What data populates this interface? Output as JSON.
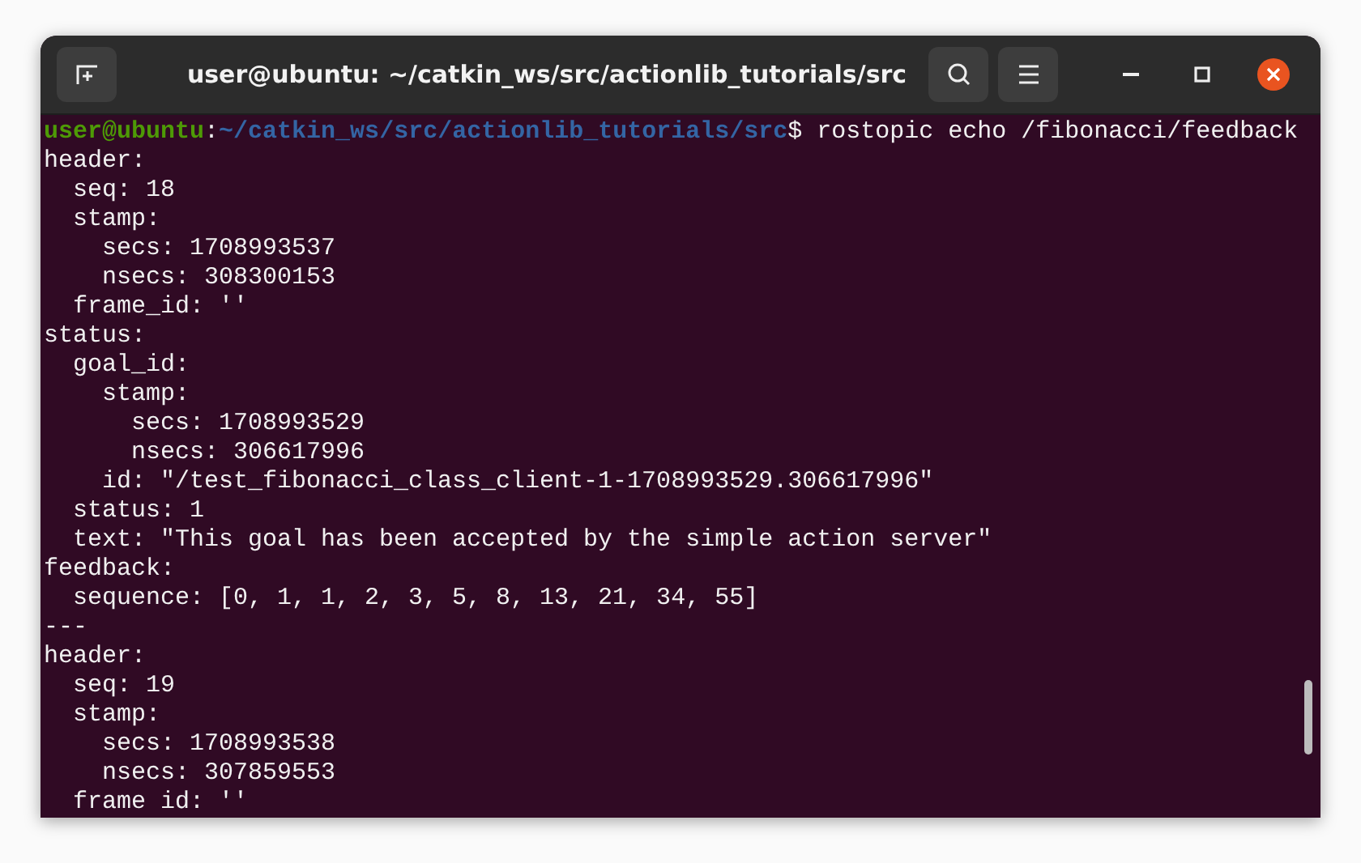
{
  "window": {
    "title": "user@ubuntu: ~/catkin_ws/src/actionlib_tutorials/src"
  },
  "prompt": {
    "user_host": "user@ubuntu",
    "separator": ":",
    "path": "~/catkin_ws/src/actionlib_tutorials/src",
    "command": "$ rostopic echo /fibonacci/feedback"
  },
  "output": [
    "header:",
    "  seq: 18",
    "  stamp:",
    "    secs: 1708993537",
    "    nsecs: 308300153",
    "  frame_id: ''",
    "status:",
    "  goal_id:",
    "    stamp:",
    "      secs: 1708993529",
    "      nsecs: 306617996",
    "    id: \"/test_fibonacci_class_client-1-1708993529.306617996\"",
    "  status: 1",
    "  text: \"This goal has been accepted by the simple action server\"",
    "feedback:",
    "  sequence: [0, 1, 1, 2, 3, 5, 8, 13, 21, 34, 55]",
    "---",
    "header:",
    "  seq: 19",
    "  stamp:",
    "    secs: 1708993538",
    "    nsecs: 307859553",
    "  frame id: ''"
  ]
}
